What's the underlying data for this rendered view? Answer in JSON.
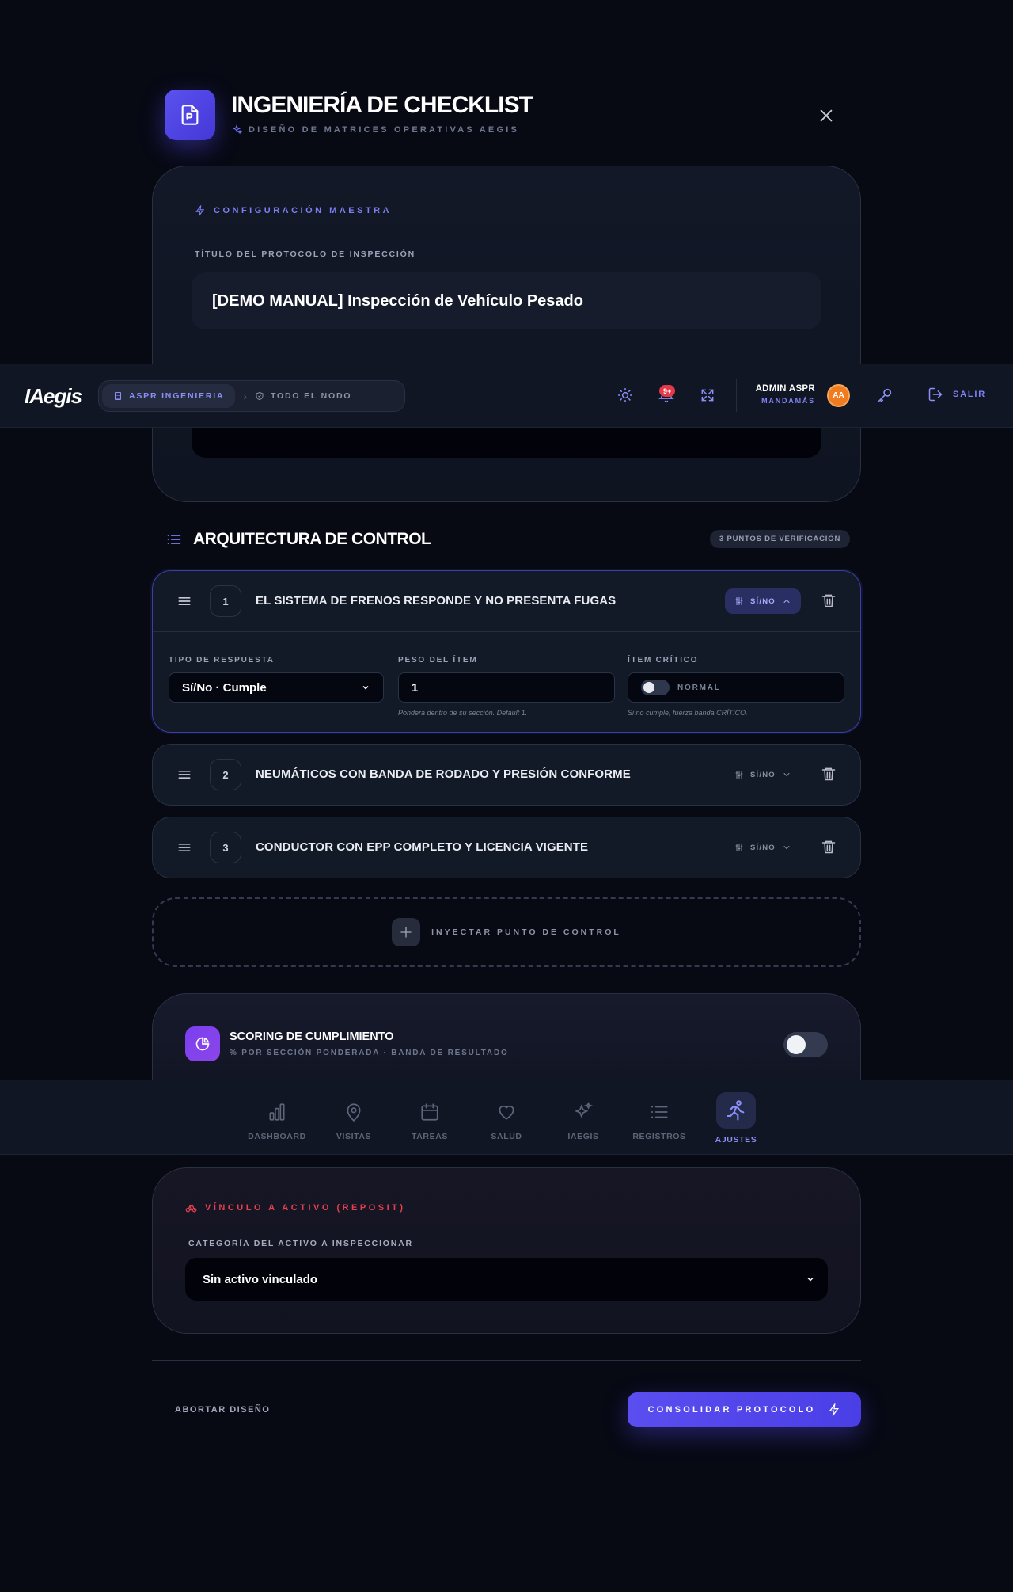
{
  "modal": {
    "title": "INGENIERÍA DE CHECKLIST",
    "subtitle": "DISEÑO DE MATRICES OPERATIVAS AEGIS"
  },
  "master": {
    "section_label": "CONFIGURACIÓN MAESTRA",
    "title_label": "TÍTULO DEL PROTOCOLO DE INSPECCIÓN",
    "title_value": "[DEMO MANUAL] Inspección de Vehículo Pesado"
  },
  "navbar": {
    "logo": "IAegis",
    "crumb_active": "ASPR INGENIERIA",
    "crumb_next": "TODO EL NODO",
    "notifications_badge": "9+",
    "user_name": "ADMIN ASPR",
    "user_role": "MANDAMÁS",
    "avatar_initials": "AA",
    "logout_label": "SALIR"
  },
  "architecture": {
    "title": "ARQUITECTURA DE CONTROL",
    "count_label": "3 PUNTOS DE VERIFICACIÓN",
    "items": [
      {
        "number": "1",
        "text": "EL SISTEMA DE FRENOS RESPONDE Y NO PRESENTA FUGAS",
        "type": "SÍ/NO",
        "expanded": true
      },
      {
        "number": "2",
        "text": "NEUMÁTICOS CON BANDA DE RODADO Y PRESIÓN CONFORME",
        "type": "SÍ/NO",
        "expanded": false
      },
      {
        "number": "3",
        "text": "CONDUCTOR CON EPP COMPLETO Y LICENCIA VIGENTE",
        "type": "SÍ/NO",
        "expanded": false
      }
    ],
    "detail": {
      "response_type_label": "TIPO DE RESPUESTA",
      "response_type_value": "Sí/No · Cumple",
      "weight_label": "PESO DEL ÍTEM",
      "weight_value": "1",
      "weight_hint": "Pondera dentro de su sección. Default 1.",
      "critical_label": "ÍTEM CRÍTICO",
      "critical_state": "NORMAL",
      "critical_hint": "Si no cumple, fuerza banda CRÍTICO."
    },
    "inject_label": "INYECTAR PUNTO DE CONTROL"
  },
  "scoring": {
    "title": "SCORING DE CUMPLIMIENTO",
    "subtitle": "% POR SECCIÓN PONDERADA · BANDA DE RESULTADO",
    "enabled": false
  },
  "bottom_nav": {
    "tabs": [
      {
        "label": "DASHBOARD",
        "icon": "bar-chart-icon"
      },
      {
        "label": "VISITAS",
        "icon": "map-pin-icon"
      },
      {
        "label": "TAREAS",
        "icon": "calendar-icon"
      },
      {
        "label": "SALUD",
        "icon": "heart-icon"
      },
      {
        "label": "IAEGIS",
        "icon": "sparkles-icon"
      },
      {
        "label": "REGISTROS",
        "icon": "list-icon"
      },
      {
        "label": "AJUSTES",
        "icon": "runner-icon",
        "active": true
      }
    ]
  },
  "asset": {
    "section_label": "VÍNCULO A ACTIVO (REPOSIT)",
    "category_label": "CATEGORÍA DEL ACTIVO A INSPECCIONAR",
    "category_value": "Sin activo vinculado"
  },
  "footer": {
    "abort_label": "ABORTAR DISEÑO",
    "consolidate_label": "CONSOLIDAR PROTOCOLO"
  },
  "colors": {
    "accent": "#5a4ef0",
    "danger": "#e5404f",
    "background": "#070913"
  }
}
